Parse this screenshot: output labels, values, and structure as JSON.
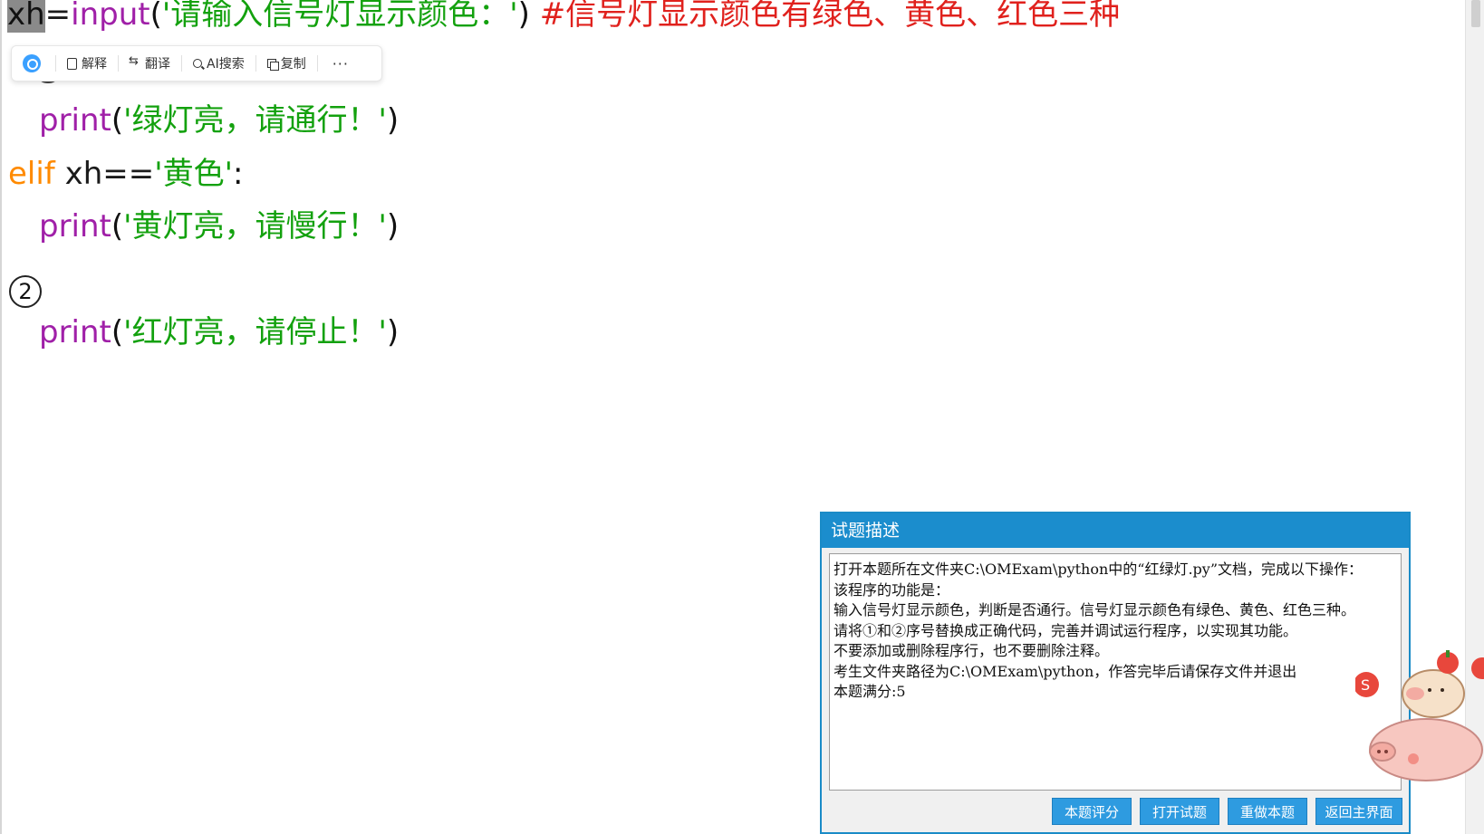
{
  "code": {
    "line1": {
      "var": "xh",
      "op": "=",
      "fn": "input",
      "open": "(",
      "str": "'请输入信号灯显示颜色：'",
      "close": ")",
      "comment": "#信号灯显示颜色有绿色、黄色、红色三种"
    },
    "line2": {
      "fn": "print",
      "open": "(",
      "str": "'绿灯亮，请通行！'",
      "close": ")"
    },
    "line3": {
      "kw": "elif",
      "var": "xh==",
      "str": "'黄色'",
      "colon": ":"
    },
    "line4": {
      "fn": "print",
      "open": "(",
      "str": "'黄灯亮，请慢行！'",
      "close": ")"
    },
    "line5": {
      "blank": "2"
    },
    "line6": {
      "fn": "print",
      "open": "(",
      "str": "'红灯亮，请停止！'",
      "close": ")"
    }
  },
  "toolbar": {
    "explain": "解释",
    "translate": "翻译",
    "ai_search": "AI搜索",
    "copy": "复制",
    "more": "···"
  },
  "dialog": {
    "title": "试题描述",
    "lines": [
      "打开本题所在文件夹C:\\OMExam\\python中的“红绿灯.py”文档，完成以下操作：",
      "该程序的功能是：",
      "输入信号灯显示颜色，判断是否通行。信号灯显示颜色有绿色、黄色、红色三种。",
      "请将①和②序号替换成正确代码，完善并调试运行程序，以实现其功能。",
      "不要添加或删除程序行，也不要删除注释。",
      "考生文件夹路径为C:\\OMExam\\python，作答完毕后请保存文件并退出",
      "本题满分:5"
    ],
    "buttons": {
      "score": "本题评分",
      "open": "打开试题",
      "redo": "重做本题",
      "home": "返回主界面"
    }
  },
  "colors": {
    "keyword": "#ff8a00",
    "function": "#a020a8",
    "string": "#13a10e",
    "comment": "#e0211d",
    "dialog_title": "#1b8dcd",
    "dialog_button": "#2e9be0"
  }
}
